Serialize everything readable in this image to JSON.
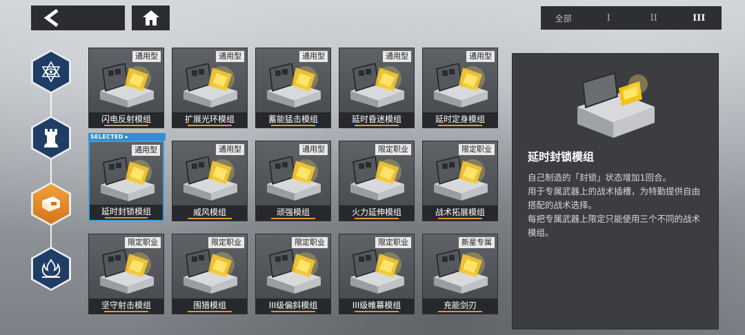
{
  "colors": {
    "accent": "#e09a2e",
    "selected": "#2e8fd3",
    "nav_active": "#f0a23a",
    "nav_idle": "#1f3d66"
  },
  "tiers": {
    "all": "全部",
    "t1": "I",
    "t2": "II",
    "t3": "III",
    "active": "III"
  },
  "side_nav": [
    {
      "icon": "star-eye-icon"
    },
    {
      "icon": "chess-rook-icon"
    },
    {
      "icon": "module-case-icon",
      "active": true
    },
    {
      "icon": "flame-wing-icon"
    }
  ],
  "selected_badge": "SELECTED ▸",
  "modules": [
    {
      "name": "闪电反射模组",
      "tag": "通用型"
    },
    {
      "name": "扩展光环模组",
      "tag": "通用型"
    },
    {
      "name": "蓄能猛击模组",
      "tag": "通用型"
    },
    {
      "name": "延时昏迷模组",
      "tag": "通用型"
    },
    {
      "name": "延时定身模组",
      "tag": "通用型"
    },
    {
      "name": "延时封锁模组",
      "tag": "通用型",
      "selected": true
    },
    {
      "name": "威风模组",
      "tag": "通用型"
    },
    {
      "name": "顽强模组",
      "tag": "通用型"
    },
    {
      "name": "火力延伸模组",
      "tag": "限定职业"
    },
    {
      "name": "战术拓展模组",
      "tag": "限定职业"
    },
    {
      "name": "坚守射击模组",
      "tag": "限定职业"
    },
    {
      "name": "围猎模组",
      "tag": "限定职业"
    },
    {
      "name": "III级偏斜模组",
      "tag": "限定职业"
    },
    {
      "name": "III级帷幕模组",
      "tag": "限定职业"
    },
    {
      "name": "充能剑刃",
      "tag": "新星专属"
    }
  ],
  "detail": {
    "title": "延时封锁模组",
    "lines": [
      "自己制造的「封锁」状态增加1回合。",
      "用于专属武器上的战术插槽，为特勤提供自由搭配的战术选择。",
      "每把专属武器上限定只能使用三个不同的战术模组。"
    ]
  }
}
